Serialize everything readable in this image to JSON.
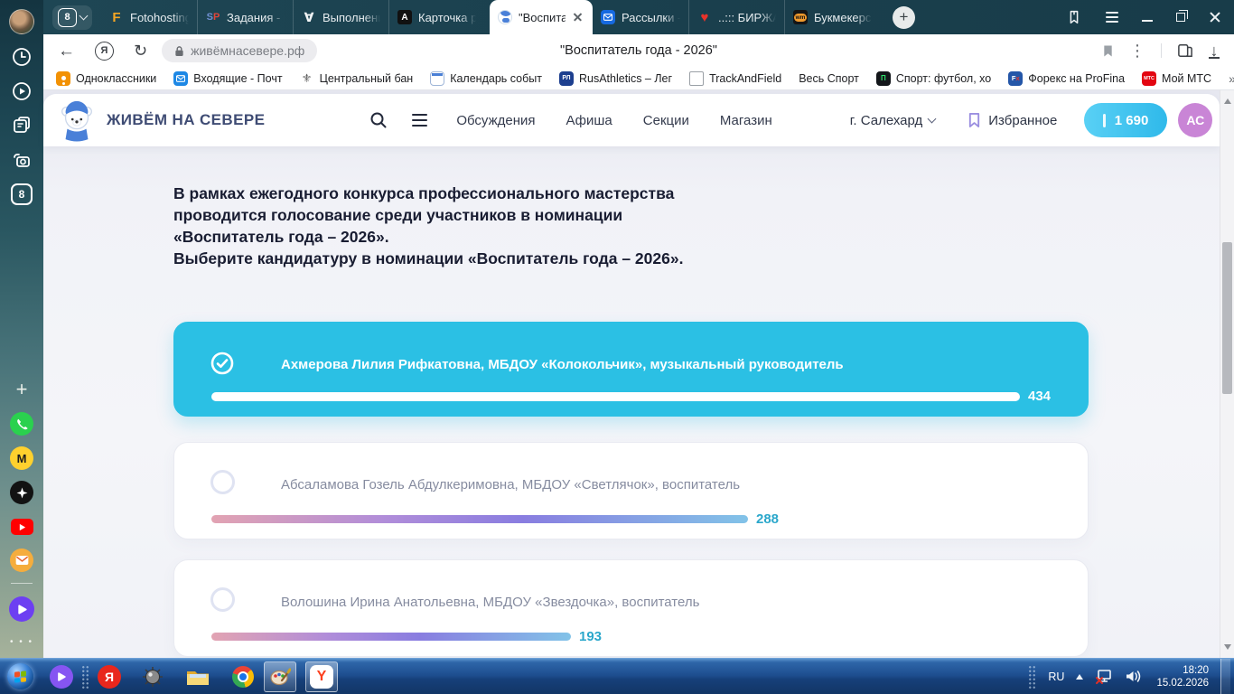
{
  "glyphs": {
    "back": "←",
    "refresh": "↻",
    "ya": "Я",
    "more_vertical": "⋮",
    "download": "↓",
    "new_tab": "+",
    "forall": "∀",
    "heart": "♥",
    "plus": "+",
    "dots": "• • •"
  },
  "browser": {
    "profile_badge": "8",
    "tabs": [
      {
        "label": "Fotohosting"
      },
      {
        "label": "Задания - о"
      },
      {
        "label": "Выполнение"
      },
      {
        "label": "Карточка ра"
      },
      {
        "label": "\"Воспита",
        "active": true
      },
      {
        "label": "Рассылки -"
      },
      {
        "label": "..::: БИРЖА"
      },
      {
        "label": "Букмекерск"
      }
    ],
    "toolbar": {
      "url": "живёмнасевере.рф",
      "page_title": "\"Воспитатель года - 2026\""
    },
    "bookmarks": [
      "Одноклассники",
      "Входящие - Почт",
      "Центральный бан",
      "Календарь событ",
      "RusAthletics – Лег",
      "TrackAndField",
      "Весь Спорт",
      "Спорт: футбол, хо",
      "Форекс на ProFina",
      "Мой МТС"
    ],
    "bookmarks_overflow": "»",
    "tab_icon_letters": {
      "foto": "F",
      "sp_s": "S",
      "sp_p": "P",
      "card": "A",
      "wm": "wm"
    }
  },
  "bookmark_icon_letters": {
    "rus": "РЛ",
    "sport": "П",
    "fx_f": "F",
    "fx_x": "x",
    "mts": "МТС",
    "eagle": "⚜"
  },
  "sidebar": {
    "tab_badge": "8"
  },
  "site": {
    "brand": "ЖИВЁМ НА СЕВЕРЕ",
    "nav": [
      "Обсуждения",
      "Афиша",
      "Секции",
      "Магазин"
    ],
    "city": "г. Салехард",
    "favorites": "Избранное",
    "points": "1 690",
    "avatar_initials": "АС"
  },
  "content": {
    "intro_1": "В рамках ежегодного конкурса профессионального мастерства проводится голосование среди участников в номинации «Воспитатель года – 2026».",
    "intro_2": "Выберите кандидатуру в номинации «Воспитатель года – 2026».",
    "options": [
      {
        "label": "Ахмерова Лилия Рифкатовна, МБДОУ «Колокольчик», музыкальный руководитель",
        "votes": 434,
        "selected": true
      },
      {
        "label": "Абсаламова Гозель Абдулкеримовна, МБДОУ «Светлячок», воспитатель",
        "votes": 288,
        "selected": false
      },
      {
        "label": "Волошина Ирина Анатольевна, МБДОУ «Звездочка», воспитатель",
        "votes": 193,
        "selected": false
      }
    ]
  },
  "taskbar": {
    "language": "RU",
    "time": "18:20",
    "date": "15.02.2026"
  },
  "taskbar_letters": {
    "yandex": "Я",
    "ybrowser": "Y"
  },
  "colors": {
    "selected_card": "#2bc0e4",
    "bar_gradient_start": "#e2a3b2",
    "bar_gradient_mid": "#897de0",
    "bar_gradient_end": "#82c3e8",
    "vote_count": "#2aa7cb",
    "points_pill": "#3cc3ef",
    "avatar_bg": "#c985d6",
    "brand_text": "#3f4c74",
    "tabbar_bg": "#1d4250"
  }
}
